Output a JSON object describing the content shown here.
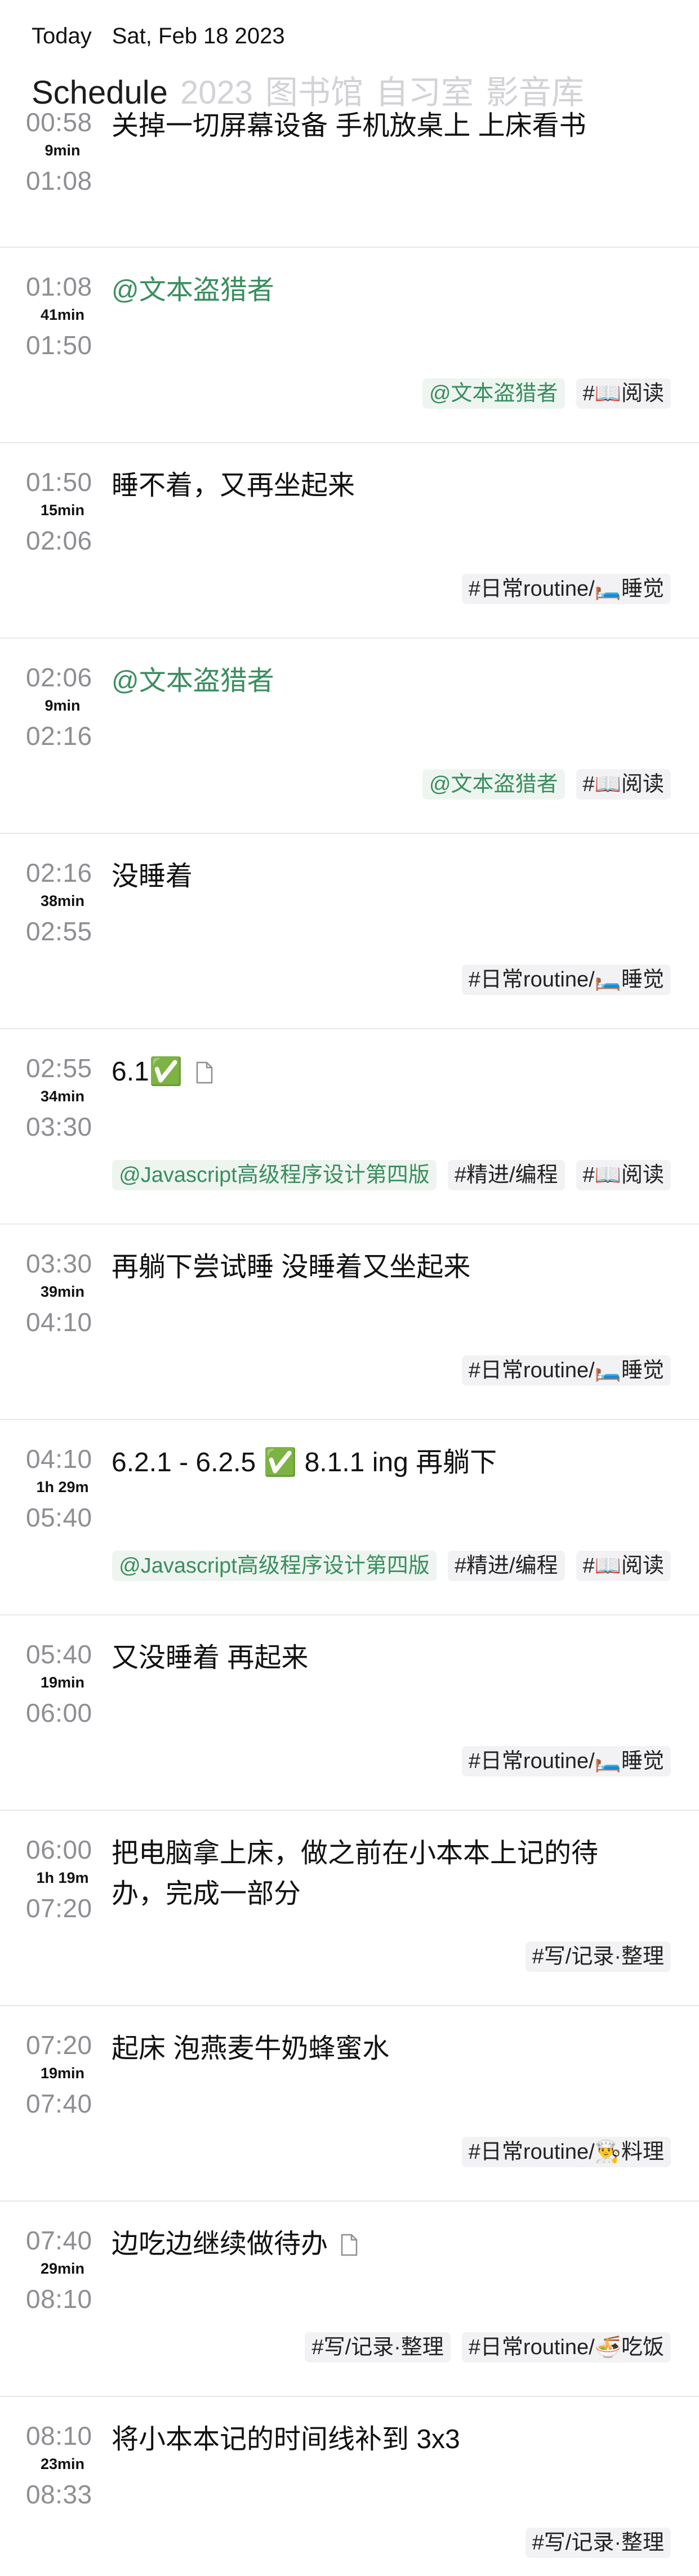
{
  "header": {
    "today_label": "Today",
    "date": "Sat, Feb 18 2023",
    "tabs": [
      "Schedule",
      "2023",
      "图书馆",
      "自习室",
      "影音库"
    ]
  },
  "entries": [
    {
      "start": "00:58",
      "duration": "9min",
      "end": "01:08",
      "title": "关掉一切屏幕设备 手机放桌上 上床看书",
      "mention": false,
      "doc_icon": false,
      "tags": []
    },
    {
      "start": "01:08",
      "duration": "41min",
      "end": "01:50",
      "title": "@文本盗猎者",
      "mention": true,
      "doc_icon": false,
      "tags": [
        {
          "text": "@文本盗猎者",
          "green": true
        },
        {
          "text": "#📖阅读",
          "green": false
        }
      ]
    },
    {
      "start": "01:50",
      "duration": "15min",
      "end": "02:06",
      "title": "睡不着，又再坐起来",
      "mention": false,
      "doc_icon": false,
      "tags": [
        {
          "text": "#日常routine/🛏️睡觉",
          "green": false
        }
      ]
    },
    {
      "start": "02:06",
      "duration": "9min",
      "end": "02:16",
      "title": "@文本盗猎者",
      "mention": true,
      "doc_icon": false,
      "tags": [
        {
          "text": "@文本盗猎者",
          "green": true
        },
        {
          "text": "#📖阅读",
          "green": false
        }
      ]
    },
    {
      "start": "02:16",
      "duration": "38min",
      "end": "02:55",
      "title": "没睡着",
      "mention": false,
      "doc_icon": false,
      "tags": [
        {
          "text": "#日常routine/🛏️睡觉",
          "green": false
        }
      ]
    },
    {
      "start": "02:55",
      "duration": "34min",
      "end": "03:30",
      "title": "6.1✅",
      "mention": false,
      "doc_icon": true,
      "tags": [
        {
          "text": "@Javascript高级程序设计第四版",
          "green": true
        },
        {
          "text": "#精进/编程",
          "green": false
        },
        {
          "text": "#📖阅读",
          "green": false
        }
      ]
    },
    {
      "start": "03:30",
      "duration": "39min",
      "end": "04:10",
      "title": "再躺下尝试睡 没睡着又坐起来",
      "mention": false,
      "doc_icon": false,
      "tags": [
        {
          "text": "#日常routine/🛏️睡觉",
          "green": false
        }
      ]
    },
    {
      "start": "04:10",
      "duration": "1h 29m",
      "end": "05:40",
      "title": "6.2.1 - 6.2.5 ✅ 8.1.1 ing 再躺下",
      "mention": false,
      "doc_icon": false,
      "tags": [
        {
          "text": "@Javascript高级程序设计第四版",
          "green": true
        },
        {
          "text": "#精进/编程",
          "green": false
        },
        {
          "text": "#📖阅读",
          "green": false
        }
      ]
    },
    {
      "start": "05:40",
      "duration": "19min",
      "end": "06:00",
      "title": "又没睡着 再起来",
      "mention": false,
      "doc_icon": false,
      "tags": [
        {
          "text": "#日常routine/🛏️睡觉",
          "green": false
        }
      ]
    },
    {
      "start": "06:00",
      "duration": "1h 19m",
      "end": "07:20",
      "title": "把电脑拿上床，做之前在小本本上记的待办，完成一部分",
      "mention": false,
      "doc_icon": false,
      "tags": [
        {
          "text": "#写/记录·整理",
          "green": false
        }
      ]
    },
    {
      "start": "07:20",
      "duration": "19min",
      "end": "07:40",
      "title": "起床 泡燕麦牛奶蜂蜜水",
      "mention": false,
      "doc_icon": false,
      "tags": [
        {
          "text": "#日常routine/👨‍🍳料理",
          "green": false
        }
      ]
    },
    {
      "start": "07:40",
      "duration": "29min",
      "end": "08:10",
      "title": "边吃边继续做待办",
      "mention": false,
      "doc_icon": true,
      "tags": [
        {
          "text": "#写/记录·整理",
          "green": false
        },
        {
          "text": "#日常routine/🍜吃饭",
          "green": false
        }
      ]
    },
    {
      "start": "08:10",
      "duration": "23min",
      "end": "08:33",
      "title": "将小本本记的时间线补到 3x3",
      "mention": false,
      "doc_icon": false,
      "tags": [
        {
          "text": "#写/记录·整理",
          "green": false
        }
      ]
    }
  ]
}
